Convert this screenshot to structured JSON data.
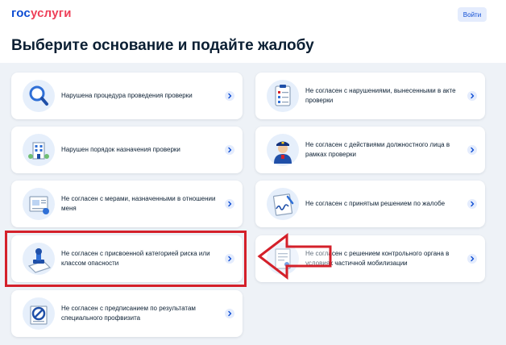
{
  "header": {
    "logo_part1": "гос",
    "logo_part2": "услуги",
    "login_label": "Войти"
  },
  "page": {
    "title": "Выберите основание и подайте жалобу"
  },
  "cards": [
    {
      "label": "Нарушена процедура проведения проверки",
      "icon": "magnifier-icon"
    },
    {
      "label": "Не согласен с нарушениями, вынесенными в акте проверки",
      "icon": "clipboard-checklist-icon"
    },
    {
      "label": "Нарушен порядок назначения проверки",
      "icon": "building-icon"
    },
    {
      "label": "Не согласен с действиями должностного лица в рамках проверки",
      "icon": "officer-icon"
    },
    {
      "label": "Не согласен с мерами, назначенными в отношении меня",
      "icon": "document-seal-icon"
    },
    {
      "label": "Не согласен с принятым решением по жалобе",
      "icon": "signed-document-icon"
    },
    {
      "label": "Не согласен с присвоенной категорией риска или классом опасности",
      "icon": "stamp-icon"
    },
    {
      "label": "Не согласен с решением контрольного органа в условиях частичной мобилизации",
      "icon": "document-icon"
    },
    {
      "label": "Не согласен с предписанием по результатам специального профвизита",
      "icon": "prohibition-icon"
    }
  ],
  "colors": {
    "brand_blue": "#0d4cd3",
    "brand_red": "#ee3f58",
    "highlight_red": "#d4202a",
    "background": "#eef2f7"
  }
}
